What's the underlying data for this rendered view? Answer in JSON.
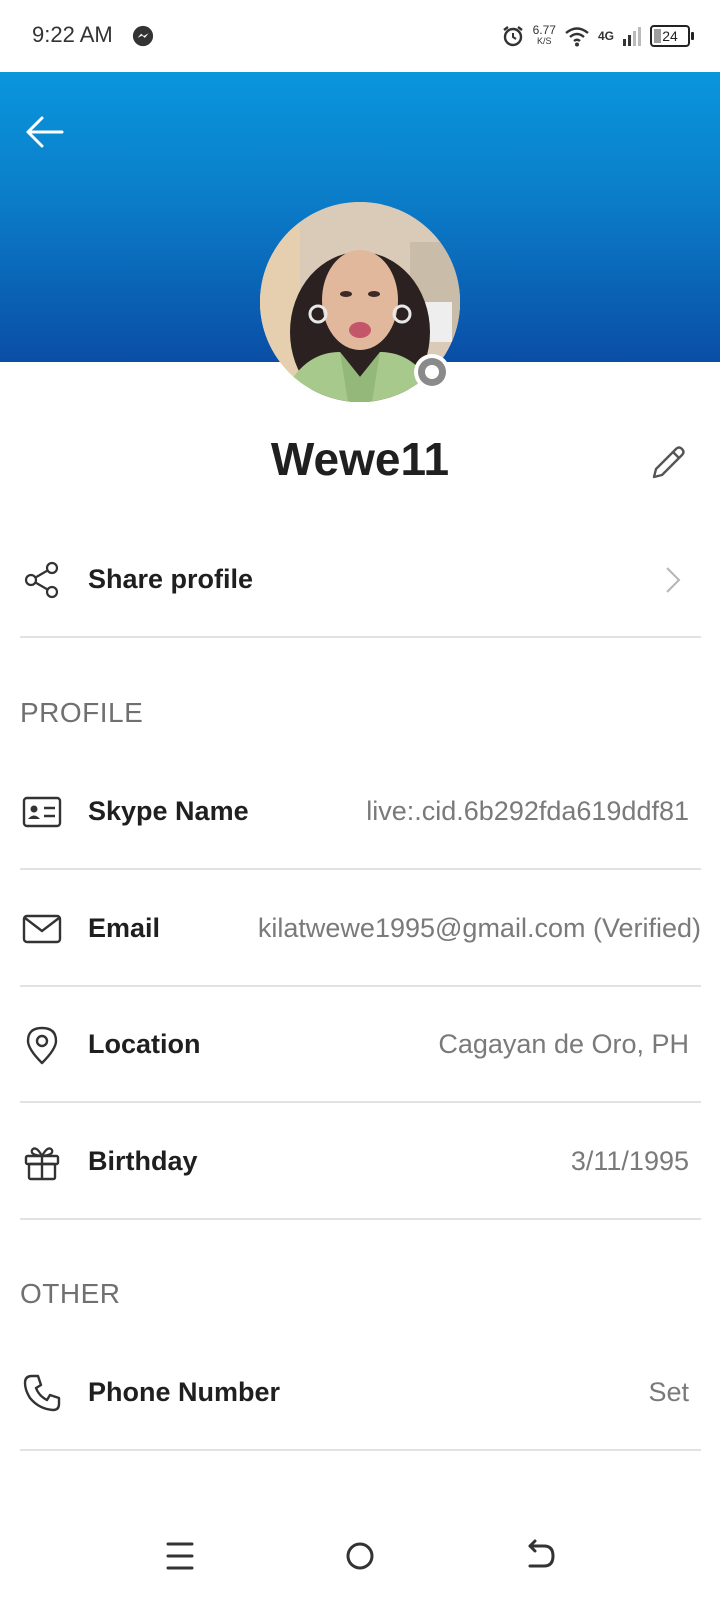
{
  "status_bar": {
    "time": "9:22 AM",
    "net_speed_value": "6.77",
    "net_speed_unit": "K/S",
    "network_type": "4G",
    "battery": "24"
  },
  "header": {
    "gradient_top": "#0a96dc",
    "gradient_bottom": "#0a4ea6"
  },
  "profile": {
    "display_name": "Wewe11",
    "presence_color": "#8a8a8a"
  },
  "share": {
    "label": "Share profile"
  },
  "sections": {
    "profile_title": "PROFILE",
    "other_title": "OTHER"
  },
  "fields": {
    "skype_name": {
      "label": "Skype Name",
      "value": "live:.cid.6b292fda619ddf81"
    },
    "email": {
      "label": "Email",
      "value": "kilatwewe1995@gmail.com (Verified)"
    },
    "location": {
      "label": "Location",
      "value": "Cagayan de Oro, PH"
    },
    "birthday": {
      "label": "Birthday",
      "value": "3/11/1995"
    },
    "phone": {
      "label": "Phone Number",
      "value": "Set"
    }
  },
  "icons": {
    "back": "arrow-left-icon",
    "edit": "pencil-icon",
    "share": "share-icon",
    "skype_name": "id-card-icon",
    "email": "mail-icon",
    "location": "location-pin-icon",
    "birthday": "gift-icon",
    "phone": "phone-icon",
    "nav_menu": "menu-icon",
    "nav_home": "home-circle-icon",
    "nav_back": "back-arrow-icon"
  }
}
